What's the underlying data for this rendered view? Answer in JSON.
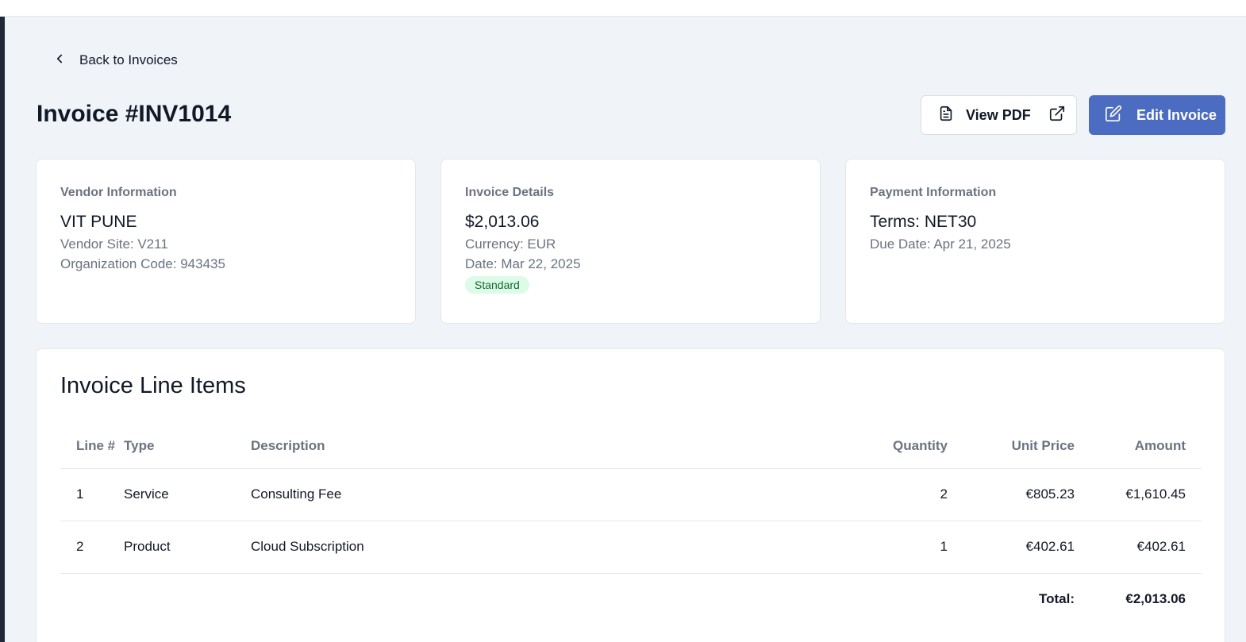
{
  "nav": {
    "back_label": "Back to Invoices"
  },
  "header": {
    "title": "Invoice #INV1014",
    "view_pdf_label": "View PDF",
    "edit_label": "Edit Invoice"
  },
  "vendor": {
    "label": "Vendor Information",
    "name": "VIT PUNE",
    "site": "Vendor Site: V211",
    "org_code": "Organization Code: 943435"
  },
  "details": {
    "label": "Invoice Details",
    "amount": "$2,013.06",
    "currency": "Currency: EUR",
    "date": "Date: Mar 22, 2025",
    "type_badge": "Standard"
  },
  "payment": {
    "label": "Payment Information",
    "terms": "Terms: NET30",
    "due_date": "Due Date: Apr 21, 2025"
  },
  "line_items": {
    "title": "Invoice Line Items",
    "columns": {
      "line": "Line #",
      "type": "Type",
      "description": "Description",
      "quantity": "Quantity",
      "unit_price": "Unit Price",
      "amount": "Amount"
    },
    "rows": [
      {
        "line": "1",
        "type": "Service",
        "description": "Consulting Fee",
        "quantity": "2",
        "unit_price": "€805.23",
        "amount": "€1,610.45"
      },
      {
        "line": "2",
        "type": "Product",
        "description": "Cloud Subscription",
        "quantity": "1",
        "unit_price": "€402.61",
        "amount": "€402.61"
      }
    ],
    "total_label": "Total:",
    "total_value": "€2,013.06"
  },
  "colors": {
    "accent": "#4b6cc1",
    "background": "#f0f3f8",
    "badge_bg": "#dcfce7",
    "badge_text": "#166534"
  },
  "icons": {
    "back": "chevron-left-icon",
    "pdf": "file-text-icon",
    "external": "external-link-icon",
    "edit": "edit-icon"
  }
}
